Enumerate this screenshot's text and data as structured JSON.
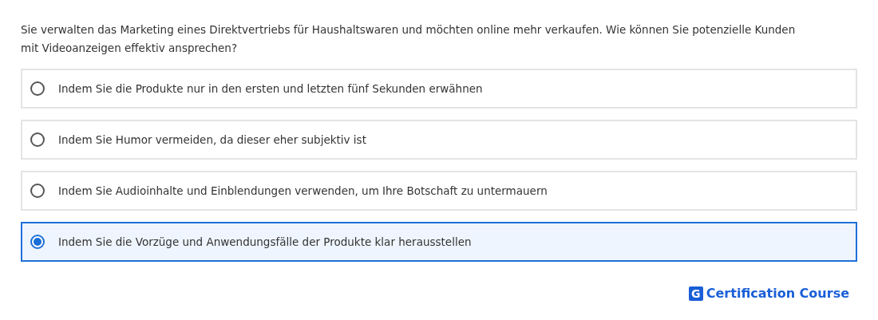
{
  "question": "Sie verwalten das Marketing eines Direktvertriebs für Haushaltswaren und möchten online mehr verkaufen. Wie können Sie potenzielle Kunden mit Videoanzeigen effektiv ansprechen?",
  "options": [
    {
      "label": "Indem Sie die Produkte nur in den ersten und letzten fünf Sekunden erwähnen",
      "selected": false
    },
    {
      "label": "Indem Sie Humor vermeiden, da dieser eher subjektiv ist",
      "selected": false
    },
    {
      "label": "Indem Sie Audioinhalte und Einblendungen verwenden, um Ihre Botschaft zu untermauern",
      "selected": false
    },
    {
      "label": "Indem Sie die Vorzüge und Anwendungsfälle der Produkte klar herausstellen",
      "selected": true
    }
  ],
  "brand": {
    "mark": "G",
    "name": "Certification Course"
  }
}
